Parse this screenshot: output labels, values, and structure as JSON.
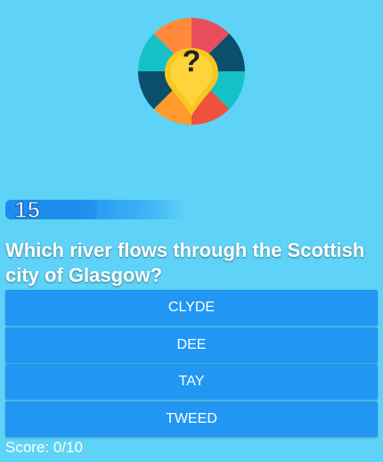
{
  "logo": {
    "icon": "question-mark-pin-icon",
    "symbol": "?",
    "colors": [
      "#f0513f",
      "#f7b733",
      "#0b4f6c",
      "#13c1c6",
      "#ff9b2a",
      "#ffffff"
    ]
  },
  "timer": {
    "value": "15",
    "progress": 0.5
  },
  "question": {
    "text": "Which river flows through the Scottish city of Glasgow?"
  },
  "answers": [
    {
      "label": "CLYDE"
    },
    {
      "label": "DEE"
    },
    {
      "label": "TAY"
    },
    {
      "label": "TWEED"
    }
  ],
  "score": {
    "label": "Score: 0/10"
  },
  "colors": {
    "background": "#5fd3f7",
    "button": "#2196f3",
    "text": "#ffffff"
  }
}
